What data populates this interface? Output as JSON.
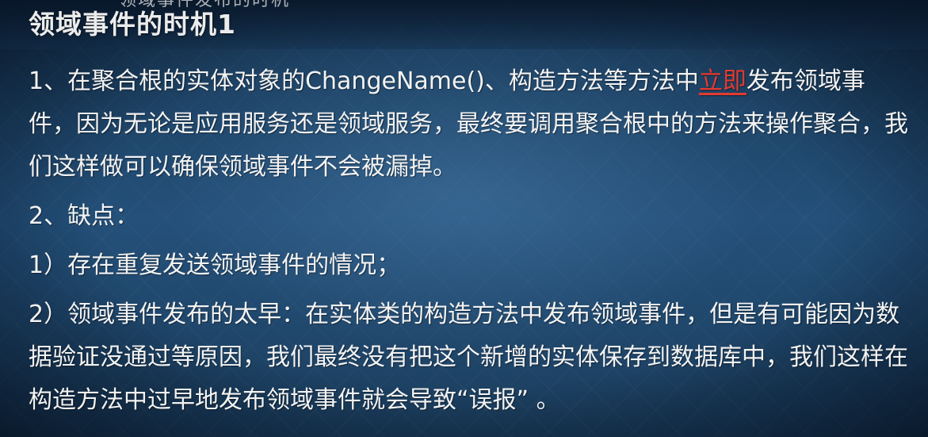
{
  "slide": {
    "header_cut_text": "领域事件发布的时机",
    "title": "领域事件的时机1",
    "paragraph1": {
      "before": "1、在聚合根的实体对象的ChangeName()、构造方法等方法中",
      "highlight": "立即",
      "after": "发布领域事件，因为无论是应用服务还是领域服务，最终要调用聚合根中的方法来操作聚合，我们这样做可以确保领域事件不会被漏掉。",
      "highlight_color": "#e53a30"
    },
    "paragraph2": "2、缺点：",
    "paragraph3": "1）存在重复发送领域事件的情况；",
    "paragraph4": "2）领域事件发布的太早：在实体类的构造方法中发布领域事件，但是有可能因为数据验证没通过等原因，我们最终没有把这个新增的实体保存到数据库中，我们这样在构造方法中过早地发布领域事件就会导致“误报” 。"
  }
}
